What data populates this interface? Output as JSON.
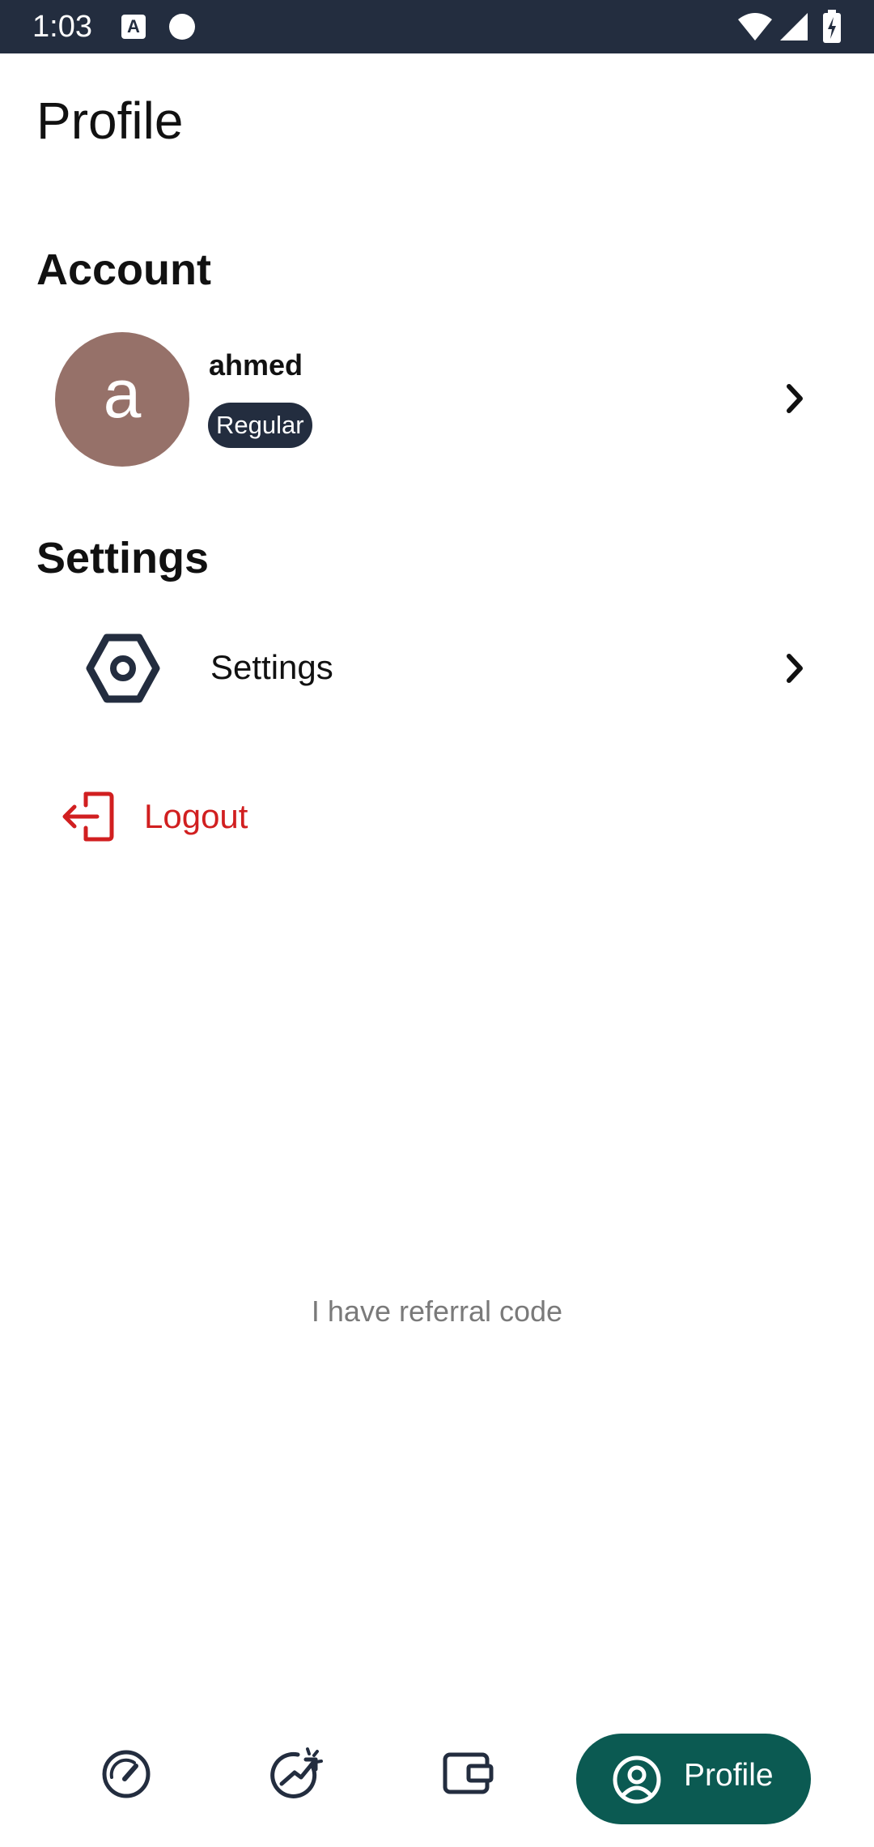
{
  "status_bar": {
    "time": "1:03",
    "notification_icons": [
      "a-letter-icon",
      "circle-icon"
    ],
    "right_icons": [
      "wifi-icon",
      "signal-icon",
      "battery-charging-icon"
    ]
  },
  "header": {
    "title": "Profile"
  },
  "account": {
    "section_title": "Account",
    "avatar_letter": "a",
    "avatar_color": "#967169",
    "name": "ahmed",
    "badge": "Regular"
  },
  "settings": {
    "section_title": "Settings",
    "item_label": "Settings",
    "item_icon": "hexagon-gear-icon"
  },
  "logout": {
    "label": "Logout",
    "icon": "logout-icon",
    "color": "#d11f20"
  },
  "referral": {
    "label": "I have referral code"
  },
  "bottom_nav": {
    "items": [
      {
        "icon": "speedometer-icon"
      },
      {
        "icon": "growth-chart-icon"
      },
      {
        "icon": "wallet-icon"
      },
      {
        "icon": "user-circle-icon",
        "label": "Profile",
        "active": true
      }
    ],
    "active_color": "#0b5a52"
  },
  "colors": {
    "dark": "#232d3f",
    "accent": "#0b5a52",
    "danger": "#d11f20"
  }
}
